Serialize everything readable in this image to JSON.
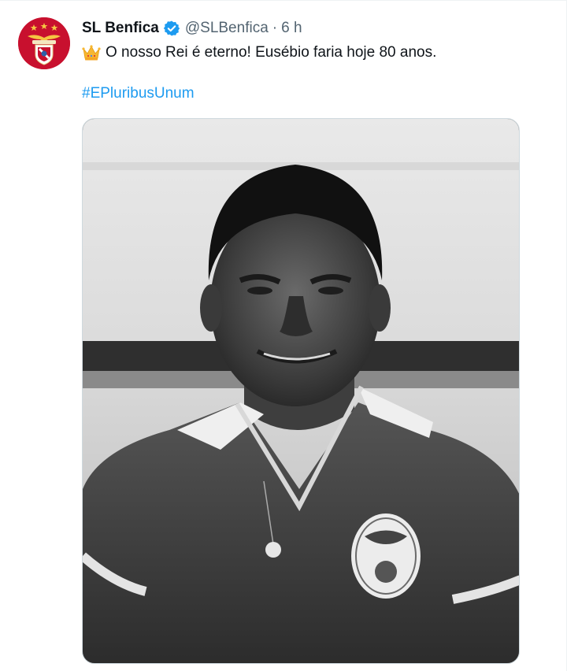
{
  "tweet": {
    "display_name": "SL Benfica",
    "handle": "@SLBenfica",
    "separator": "·",
    "time": "6 h",
    "text": "O nosso Rei é eterno! Eusébio faria hoje 80 anos.",
    "hashtag": "#EPluribusUnum",
    "emoji_icon": "crown-emoji",
    "verified_icon": "verified-badge-icon"
  },
  "colors": {
    "link": "#1d9bf0",
    "secondary_text": "#536471",
    "primary_text": "#0f1419",
    "brand_red": "#c8102e"
  },
  "media": {
    "type": "photo",
    "description_icon": "black-and-white-portrait-photo"
  }
}
